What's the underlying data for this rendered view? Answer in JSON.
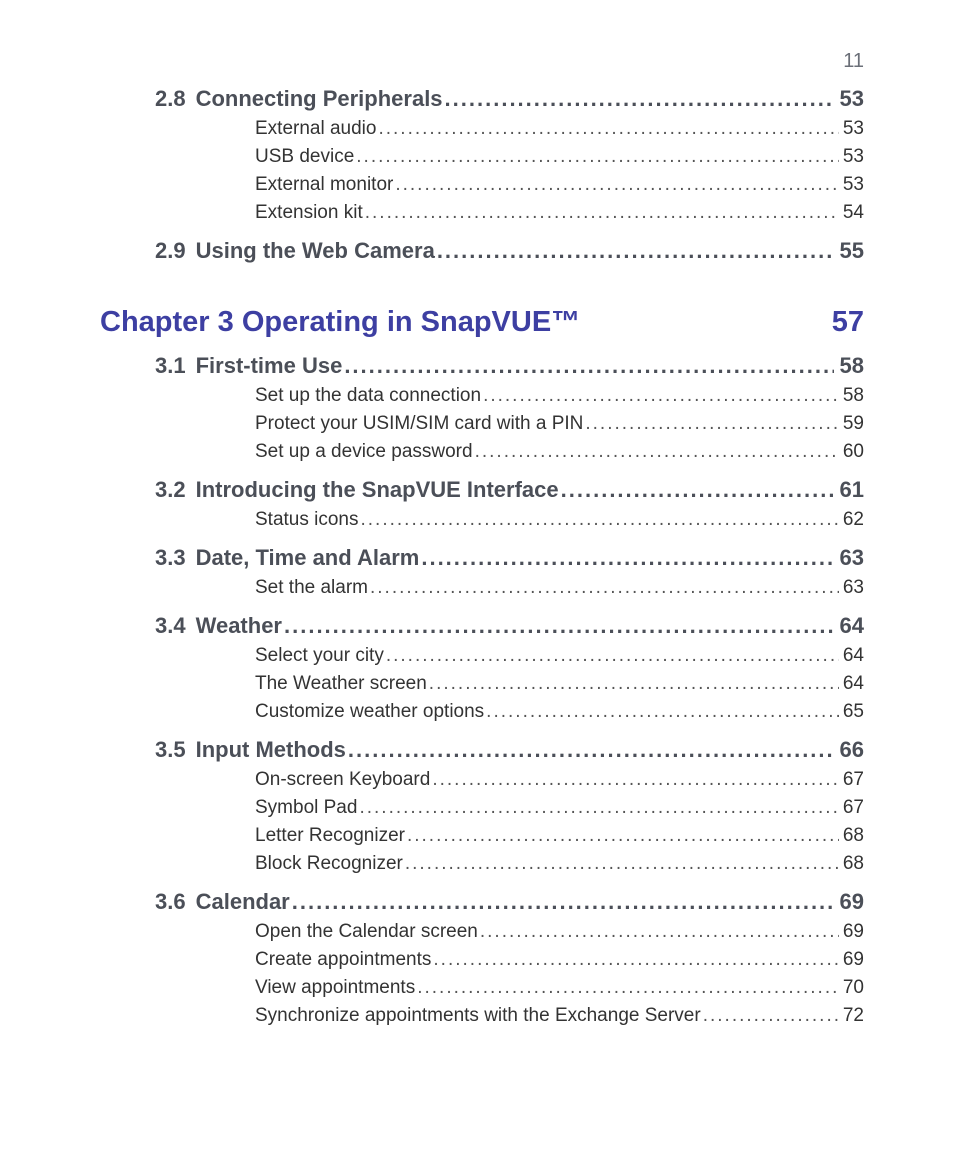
{
  "page_number": "11",
  "chapter": {
    "title": "Chapter 3  Operating in SnapVUE™",
    "page": "57"
  },
  "sections": [
    {
      "num": "2.8",
      "title": "Connecting Peripherals",
      "page": "53",
      "items": [
        {
          "title": "External audio",
          "page": "53"
        },
        {
          "title": "USB device",
          "page": "53"
        },
        {
          "title": "External monitor",
          "page": "53"
        },
        {
          "title": "Extension kit",
          "page": "54"
        }
      ]
    },
    {
      "num": "2.9",
      "title": "Using the Web Camera",
      "page": "55",
      "items": []
    }
  ],
  "sections_after": [
    {
      "num": "3.1",
      "title": "First-time Use",
      "page": "58",
      "items": [
        {
          "title": "Set up the data connection",
          "page": "58"
        },
        {
          "title": "Protect your USIM/SIM card with a PIN",
          "page": "59"
        },
        {
          "title": "Set up a device password",
          "page": "60"
        }
      ]
    },
    {
      "num": "3.2",
      "title": "Introducing the SnapVUE Interface",
      "page": "61",
      "items": [
        {
          "title": "Status icons",
          "page": "62"
        }
      ]
    },
    {
      "num": "3.3",
      "title": "Date, Time and Alarm",
      "page": "63",
      "items": [
        {
          "title": "Set the alarm",
          "page": "63"
        }
      ]
    },
    {
      "num": "3.4",
      "title": "Weather",
      "page": "64",
      "items": [
        {
          "title": "Select your city",
          "page": "64"
        },
        {
          "title": "The Weather screen",
          "page": "64"
        },
        {
          "title": "Customize weather options",
          "page": "65"
        }
      ]
    },
    {
      "num": "3.5",
      "title": "Input Methods",
      "page": "66",
      "items": [
        {
          "title": "On-screen Keyboard",
          "page": "67"
        },
        {
          "title": "Symbol Pad",
          "page": "67"
        },
        {
          "title": "Letter Recognizer",
          "page": "68"
        },
        {
          "title": "Block Recognizer",
          "page": "68"
        }
      ]
    },
    {
      "num": "3.6",
      "title": "Calendar",
      "page": "69",
      "items": [
        {
          "title": "Open the Calendar screen",
          "page": "69"
        },
        {
          "title": "Create appointments",
          "page": "69"
        },
        {
          "title": "View appointments",
          "page": "70"
        },
        {
          "title": "Synchronize appointments with the Exchange Server",
          "page": "72"
        }
      ]
    }
  ]
}
